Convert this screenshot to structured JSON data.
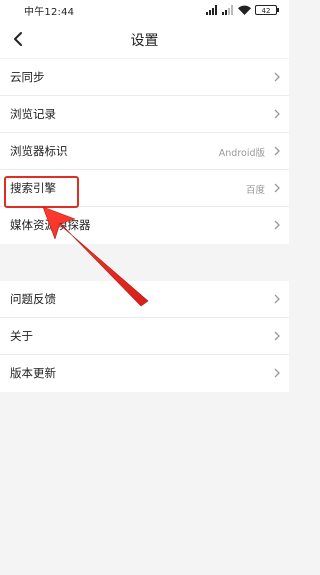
{
  "status_bar": {
    "time": "中午12:44",
    "battery": "42"
  },
  "nav": {
    "title": "设置"
  },
  "group1": [
    {
      "label": "云同步",
      "value": ""
    },
    {
      "label": "浏览记录",
      "value": ""
    },
    {
      "label": "浏览器标识",
      "value": "Android版"
    },
    {
      "label": "搜索引擎",
      "value": "百度"
    },
    {
      "label": "媒体资源嗅探器",
      "value": ""
    }
  ],
  "group2": [
    {
      "label": "问题反馈",
      "value": ""
    },
    {
      "label": "关于",
      "value": ""
    },
    {
      "label": "版本更新",
      "value": ""
    }
  ],
  "colors": {
    "annotation": "#e02e24",
    "background": "#f4f4f4"
  }
}
